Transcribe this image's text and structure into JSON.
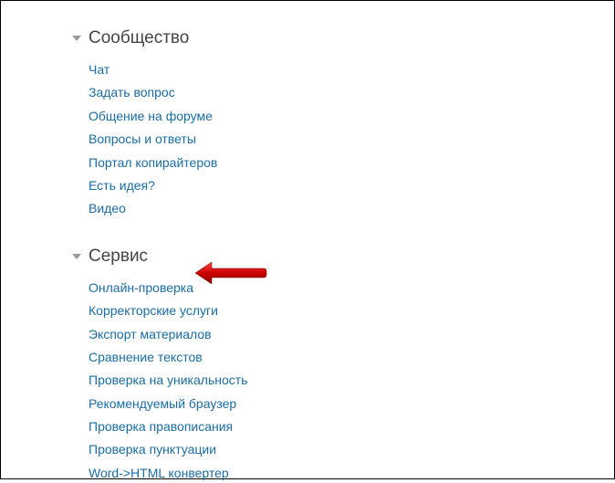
{
  "sections": [
    {
      "title": "Сообщество",
      "links": [
        "Чат",
        "Задать вопрос",
        "Общение на форуме",
        "Вопросы и ответы",
        "Портал копирайтеров",
        "Есть идея?",
        "Видео"
      ]
    },
    {
      "title": "Сервис",
      "links": [
        "Онлайн-проверка",
        "Корректорские услуги",
        "Экспорт материалов",
        "Сравнение текстов",
        "Проверка на уникальность",
        "Рекомендуемый браузер",
        "Проверка правописания",
        "Проверка пунктуации",
        "Word->HTML конвертер"
      ]
    }
  ]
}
